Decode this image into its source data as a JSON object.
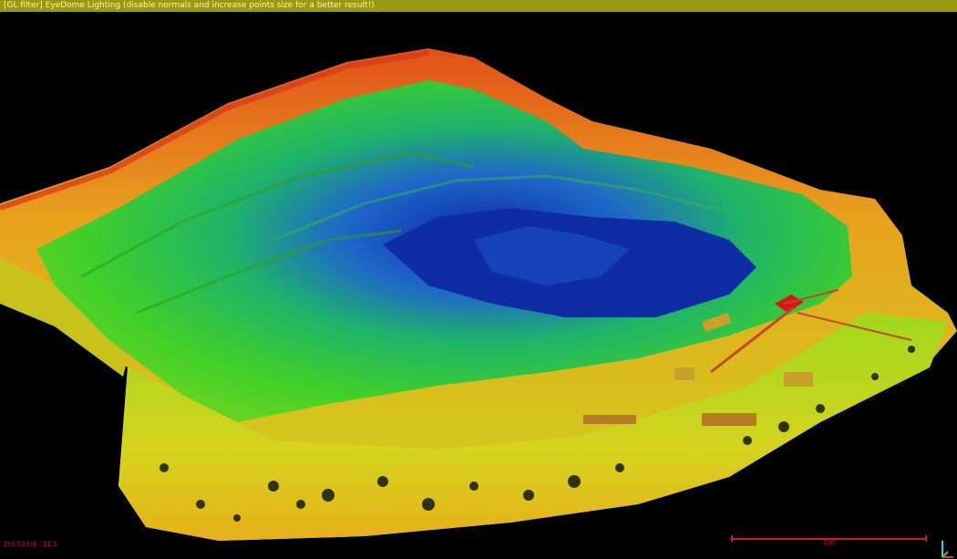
{
  "banner": {
    "text": "[GL filter] EyeDome Lighting (disable normals and increase points size for a better result!)"
  },
  "viewport": {
    "timestamp": "2017/07/3 - 21:5",
    "scale_label": "100",
    "colors": {
      "high": "#e07a1a",
      "mid": "#6bd91e",
      "low": "#0f2fb0",
      "structure": "#c83a1a",
      "background": "#000000"
    }
  }
}
